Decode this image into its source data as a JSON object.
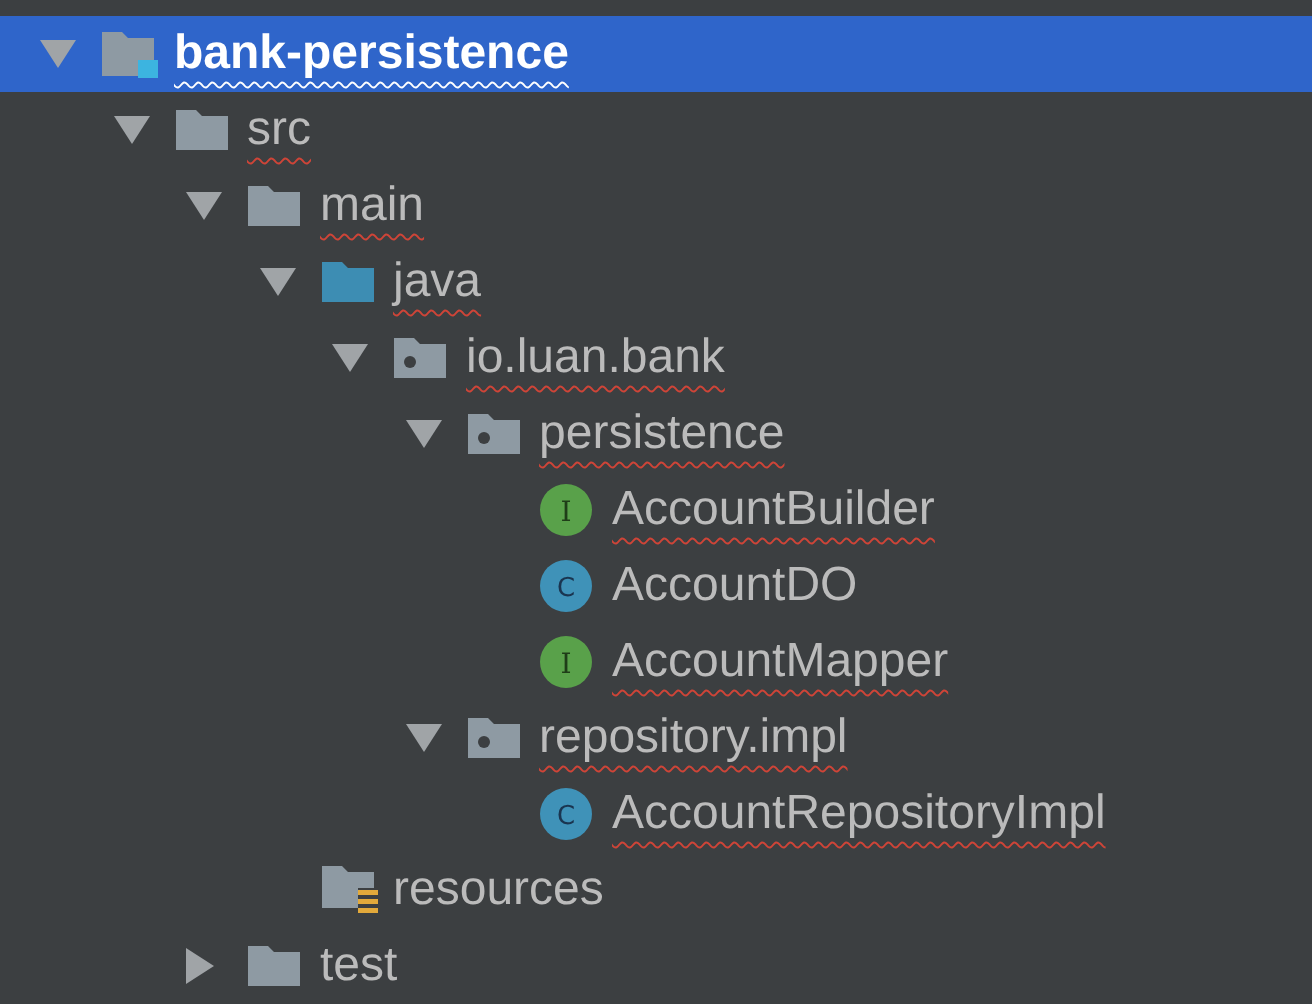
{
  "project_tree": [
    {
      "label": "bank-persistence",
      "kind": "module",
      "expanded": true,
      "selected": true,
      "misspelled": true,
      "children": [
        {
          "label": "src",
          "kind": "folder",
          "expanded": true,
          "selected": false,
          "misspelled": true,
          "children": [
            {
              "label": "main",
              "kind": "folder",
              "expanded": true,
              "selected": false,
              "misspelled": true,
              "children": [
                {
                  "label": "java",
                  "kind": "source-folder",
                  "expanded": true,
                  "selected": false,
                  "misspelled": true,
                  "children": [
                    {
                      "label": "io.luan.bank",
                      "kind": "package",
                      "expanded": true,
                      "selected": false,
                      "misspelled": true,
                      "children": [
                        {
                          "label": "persistence",
                          "kind": "package",
                          "expanded": true,
                          "selected": false,
                          "misspelled": true,
                          "children": [
                            {
                              "label": "AccountBuilder",
                              "kind": "interface",
                              "badge": "I",
                              "selected": false,
                              "misspelled": true
                            },
                            {
                              "label": "AccountDO",
                              "kind": "class",
                              "badge": "C",
                              "selected": false,
                              "misspelled": false
                            },
                            {
                              "label": "AccountMapper",
                              "kind": "interface",
                              "badge": "I",
                              "selected": false,
                              "misspelled": true
                            }
                          ]
                        },
                        {
                          "label": "repository.impl",
                          "kind": "package",
                          "expanded": true,
                          "selected": false,
                          "misspelled": true,
                          "children": [
                            {
                              "label": "AccountRepositoryImpl",
                              "kind": "class",
                              "badge": "C",
                              "selected": false,
                              "misspelled": true
                            }
                          ]
                        }
                      ]
                    }
                  ]
                },
                {
                  "label": "resources",
                  "kind": "resources-folder",
                  "selected": false,
                  "misspelled": false
                }
              ]
            },
            {
              "label": "test",
              "kind": "folder",
              "expanded": false,
              "selected": false,
              "misspelled": false
            }
          ]
        }
      ]
    }
  ]
}
